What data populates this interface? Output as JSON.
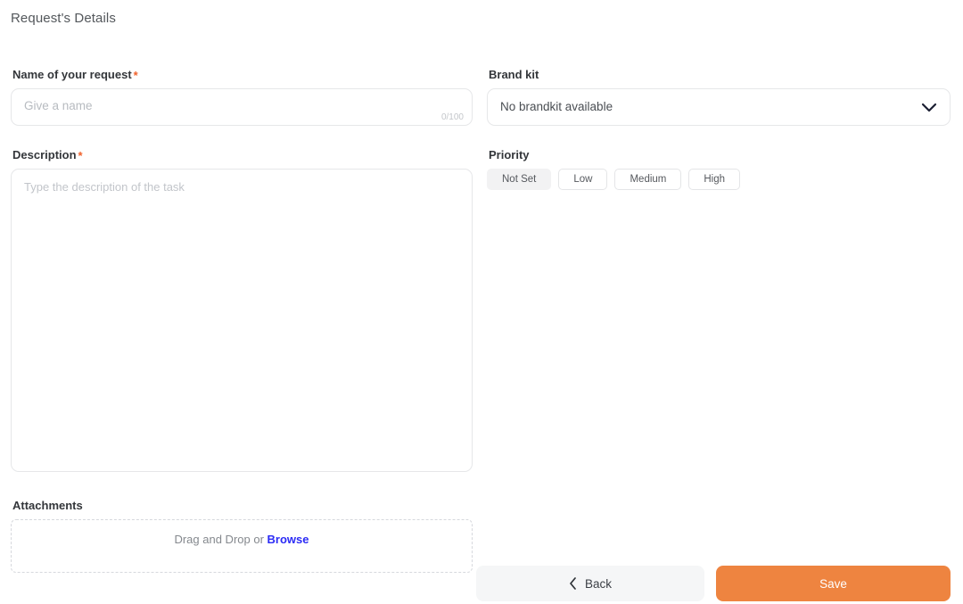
{
  "header": {
    "title": "Request's Details"
  },
  "colors": {
    "accent_orange": "#ee8440",
    "required_star": "#f0622c",
    "link_blue": "#2b2bf5",
    "chip_selected_bg": "#f2f2f3",
    "back_button_bg": "#f5f6f7",
    "border": "#e6e7e9"
  },
  "fields": {
    "name": {
      "label": "Name of your request",
      "required_marker": "*",
      "placeholder": "Give a name",
      "value": "",
      "counter": "0/100"
    },
    "description": {
      "label": "Description",
      "required_marker": "*",
      "placeholder": "Type the description of the task",
      "value": ""
    },
    "brandkit": {
      "label": "Brand kit",
      "selected": "No brandkit available",
      "chevron_icon": "chevron-down-icon"
    },
    "priority": {
      "label": "Priority",
      "options": [
        {
          "label": "Not Set",
          "selected": true
        },
        {
          "label": "Low",
          "selected": false
        },
        {
          "label": "Medium",
          "selected": false
        },
        {
          "label": "High",
          "selected": false
        }
      ]
    },
    "attachments": {
      "label": "Attachments",
      "drop_text": "Drag and Drop or",
      "browse_label": "Browse"
    }
  },
  "footer": {
    "back_label": "Back",
    "back_icon": "chevron-left-icon",
    "save_label": "Save"
  }
}
